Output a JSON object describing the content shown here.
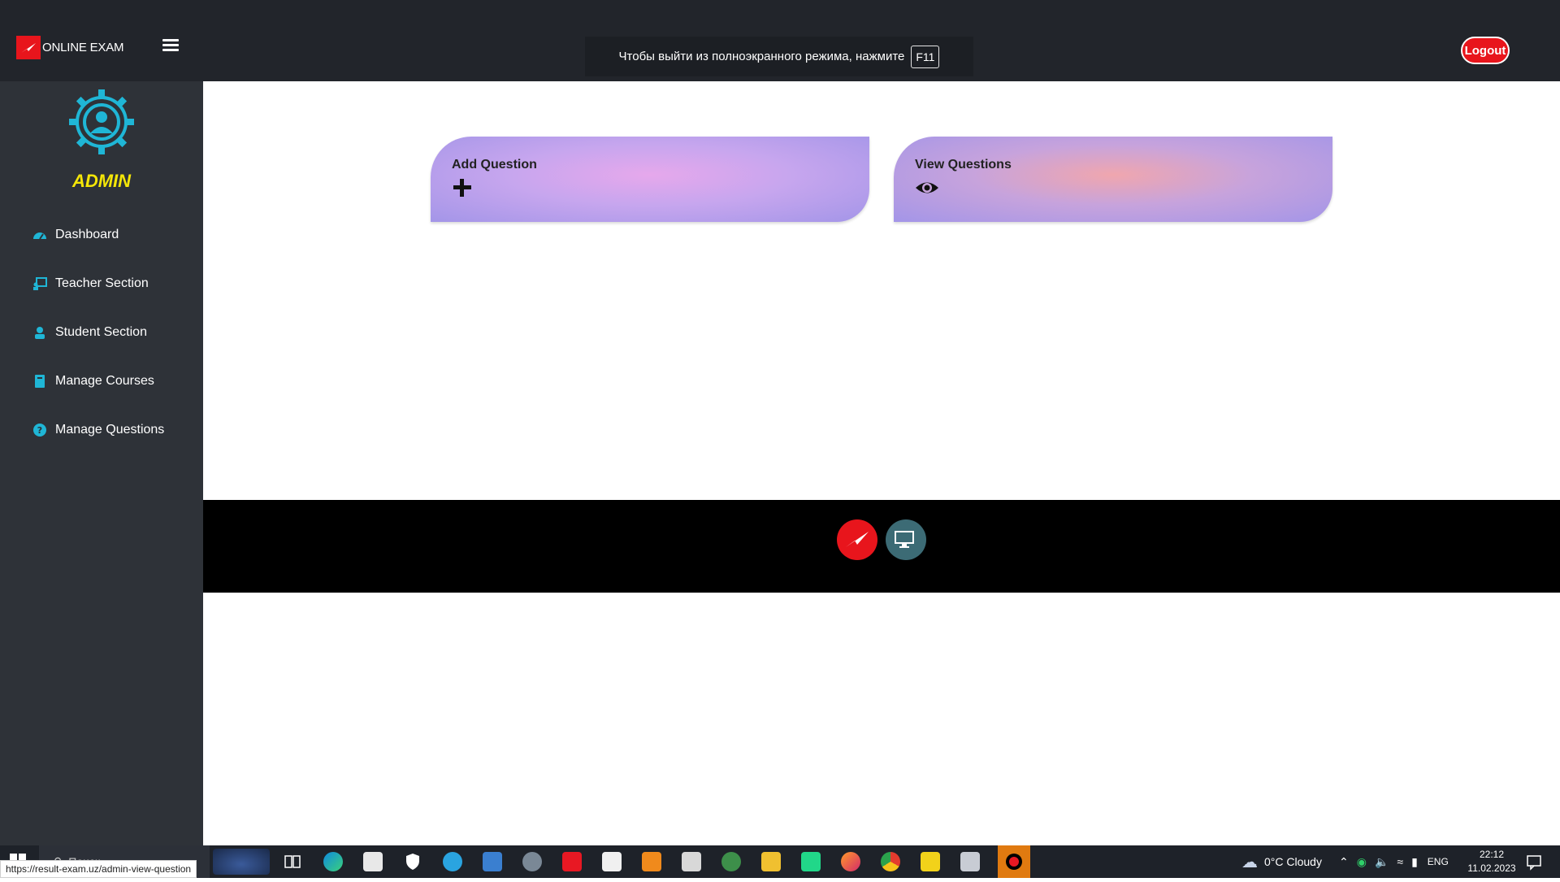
{
  "header": {
    "brand": "ONLINE EXAM",
    "fullscreen_notice": "Чтобы выйти из полноэкранного режима, нажмите",
    "fullscreen_key": "F11",
    "logout_label": "Logout"
  },
  "sidebar": {
    "title": "ADMIN",
    "items": [
      {
        "label": "Dashboard",
        "icon": "dashboard-icon"
      },
      {
        "label": "Teacher Section",
        "icon": "teacher-icon"
      },
      {
        "label": "Student Section",
        "icon": "student-icon"
      },
      {
        "label": "Manage Courses",
        "icon": "book-icon"
      },
      {
        "label": "Manage Questions",
        "icon": "question-icon"
      }
    ]
  },
  "main": {
    "cards": [
      {
        "title": "Add Question",
        "icon": "plus-icon"
      },
      {
        "title": "View Questions",
        "icon": "eye-icon"
      }
    ]
  },
  "footer": {
    "logos": [
      "brand-logo",
      "monitor-logo"
    ]
  },
  "taskbar": {
    "search_placeholder": "Поиск",
    "weather": "0°C  Cloudy",
    "language": "ENG",
    "time": "22:12",
    "date": "11.02.2023"
  },
  "status_bar": {
    "url": "https://result-exam.uz/admin-view-question"
  },
  "colors": {
    "accent_red": "#e8151c",
    "sidebar_bg": "#2e3238",
    "navbar_bg": "#22252b",
    "admin_yellow": "#f4e608",
    "icon_cyan": "#1fb6d6"
  }
}
